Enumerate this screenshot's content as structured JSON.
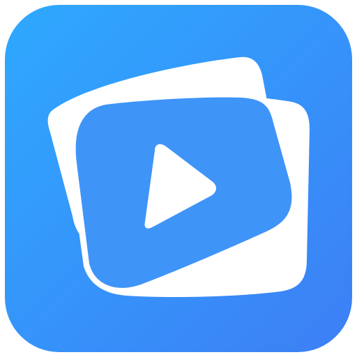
{
  "app_icon": {
    "icon": "video-player-app-icon",
    "colors": {
      "background_top": "#2ea9ff",
      "background_bottom": "#3d7ff5",
      "screen": "#3f94f8",
      "frame": "#ffffff",
      "play": "#ffffff"
    }
  }
}
